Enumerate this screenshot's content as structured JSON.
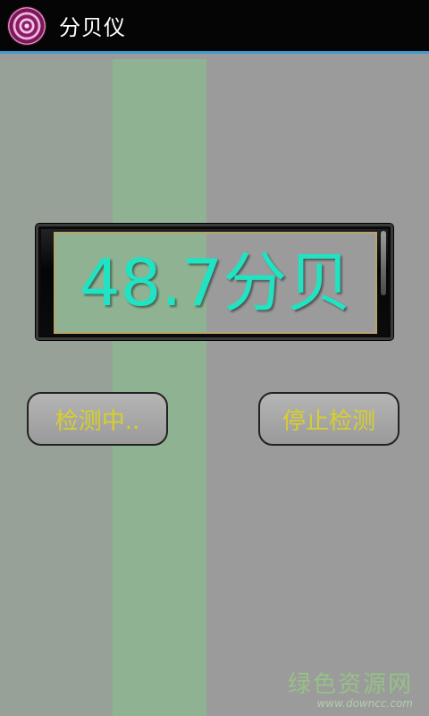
{
  "app": {
    "title": "分贝仪",
    "icon": "target-rings-icon"
  },
  "reading": {
    "value_text": "48.7分贝",
    "value": 48.7,
    "unit": "分贝"
  },
  "buttons": {
    "start_label": "检测中..",
    "stop_label": "停止检测"
  },
  "watermark": {
    "main": "绿色资源网",
    "sub": "www.downcc.com"
  },
  "colors": {
    "actionbar": "#050505",
    "accent_line": "#3a9bd1",
    "background": "#9b9b9b",
    "reading_text": "#1fe3c3",
    "button_text": "#d8cf2b",
    "band_green": "#8fb392"
  }
}
